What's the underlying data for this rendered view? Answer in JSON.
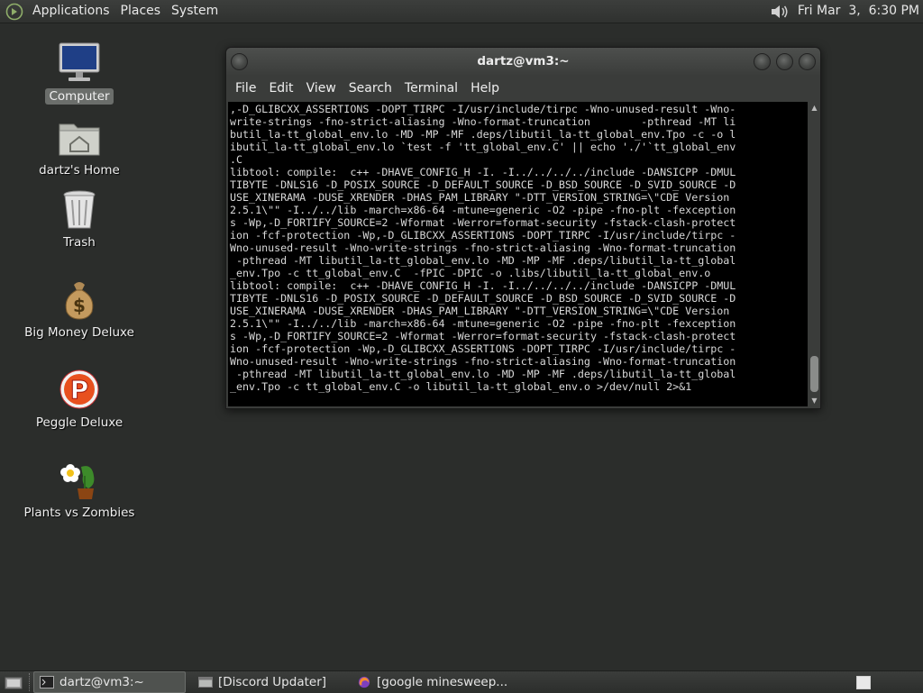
{
  "top_panel": {
    "menus": [
      "Applications",
      "Places",
      "System"
    ],
    "clock": "Fri Mar  3,  6:30 PM"
  },
  "desktop": {
    "icons": [
      {
        "label": "Computer",
        "icon": "computer-icon",
        "selected": true
      },
      {
        "label": "dartz's Home",
        "icon": "home-folder-icon"
      },
      {
        "label": "Trash",
        "icon": "trash-icon"
      },
      {
        "label": "Big Money Deluxe",
        "icon": "money-bag-icon"
      },
      {
        "label": "Peggle Deluxe",
        "icon": "peggle-icon"
      },
      {
        "label": "Plants vs Zombies",
        "icon": "plants-vs-zombies-icon"
      }
    ]
  },
  "terminal": {
    "title": "dartz@vm3:~",
    "menus": [
      "File",
      "Edit",
      "View",
      "Search",
      "Terminal",
      "Help"
    ],
    "lines": [
      ",-D_GLIBCXX_ASSERTIONS -DOPT_TIRPC -I/usr/include/tirpc -Wno-unused-result -Wno-",
      "write-strings -fno-strict-aliasing -Wno-format-truncation        -pthread -MT li",
      "butil_la-tt_global_env.lo -MD -MP -MF .deps/libutil_la-tt_global_env.Tpo -c -o l",
      "ibutil_la-tt_global_env.lo `test -f 'tt_global_env.C' || echo './'`tt_global_env",
      ".C",
      "libtool: compile:  c++ -DHAVE_CONFIG_H -I. -I../../../../include -DANSICPP -DMUL",
      "TIBYTE -DNLS16 -D_POSIX_SOURCE -D_DEFAULT_SOURCE -D_BSD_SOURCE -D_SVID_SOURCE -D",
      "USE_XINERAMA -DUSE_XRENDER -DHAS_PAM_LIBRARY \"-DTT_VERSION_STRING=\\\"CDE Version",
      "2.5.1\\\"\" -I../../lib -march=x86-64 -mtune=generic -O2 -pipe -fno-plt -fexception",
      "s -Wp,-D_FORTIFY_SOURCE=2 -Wformat -Werror=format-security -fstack-clash-protect",
      "ion -fcf-protection -Wp,-D_GLIBCXX_ASSERTIONS -DOPT_TIRPC -I/usr/include/tirpc -",
      "Wno-unused-result -Wno-write-strings -fno-strict-aliasing -Wno-format-truncation",
      " -pthread -MT libutil_la-tt_global_env.lo -MD -MP -MF .deps/libutil_la-tt_global",
      "_env.Tpo -c tt_global_env.C  -fPIC -DPIC -o .libs/libutil_la-tt_global_env.o",
      "libtool: compile:  c++ -DHAVE_CONFIG_H -I. -I../../../../include -DANSICPP -DMUL",
      "TIBYTE -DNLS16 -D_POSIX_SOURCE -D_DEFAULT_SOURCE -D_BSD_SOURCE -D_SVID_SOURCE -D",
      "USE_XINERAMA -DUSE_XRENDER -DHAS_PAM_LIBRARY \"-DTT_VERSION_STRING=\\\"CDE Version",
      "2.5.1\\\"\" -I../../lib -march=x86-64 -mtune=generic -O2 -pipe -fno-plt -fexception",
      "s -Wp,-D_FORTIFY_SOURCE=2 -Wformat -Werror=format-security -fstack-clash-protect",
      "ion -fcf-protection -Wp,-D_GLIBCXX_ASSERTIONS -DOPT_TIRPC -I/usr/include/tirpc -",
      "Wno-unused-result -Wno-write-strings -fno-strict-aliasing -Wno-format-truncation",
      " -pthread -MT libutil_la-tt_global_env.lo -MD -MP -MF .deps/libutil_la-tt_global",
      "_env.Tpo -c tt_global_env.C -o libutil_la-tt_global_env.o >/dev/null 2>&1"
    ]
  },
  "taskbar": {
    "tasks": [
      {
        "label": "dartz@vm3:~",
        "icon": "terminal-icon",
        "active": true
      },
      {
        "label": "[Discord Updater]",
        "icon": "window-icon",
        "active": false
      },
      {
        "label": "[google minesweep...",
        "icon": "firefox-icon",
        "active": false
      }
    ]
  },
  "colors": {
    "desktop_bg": "#2b2d2b",
    "panel_bg": "#363836",
    "terminal_bg": "#000000",
    "terminal_fg": "#d8d8d8"
  }
}
